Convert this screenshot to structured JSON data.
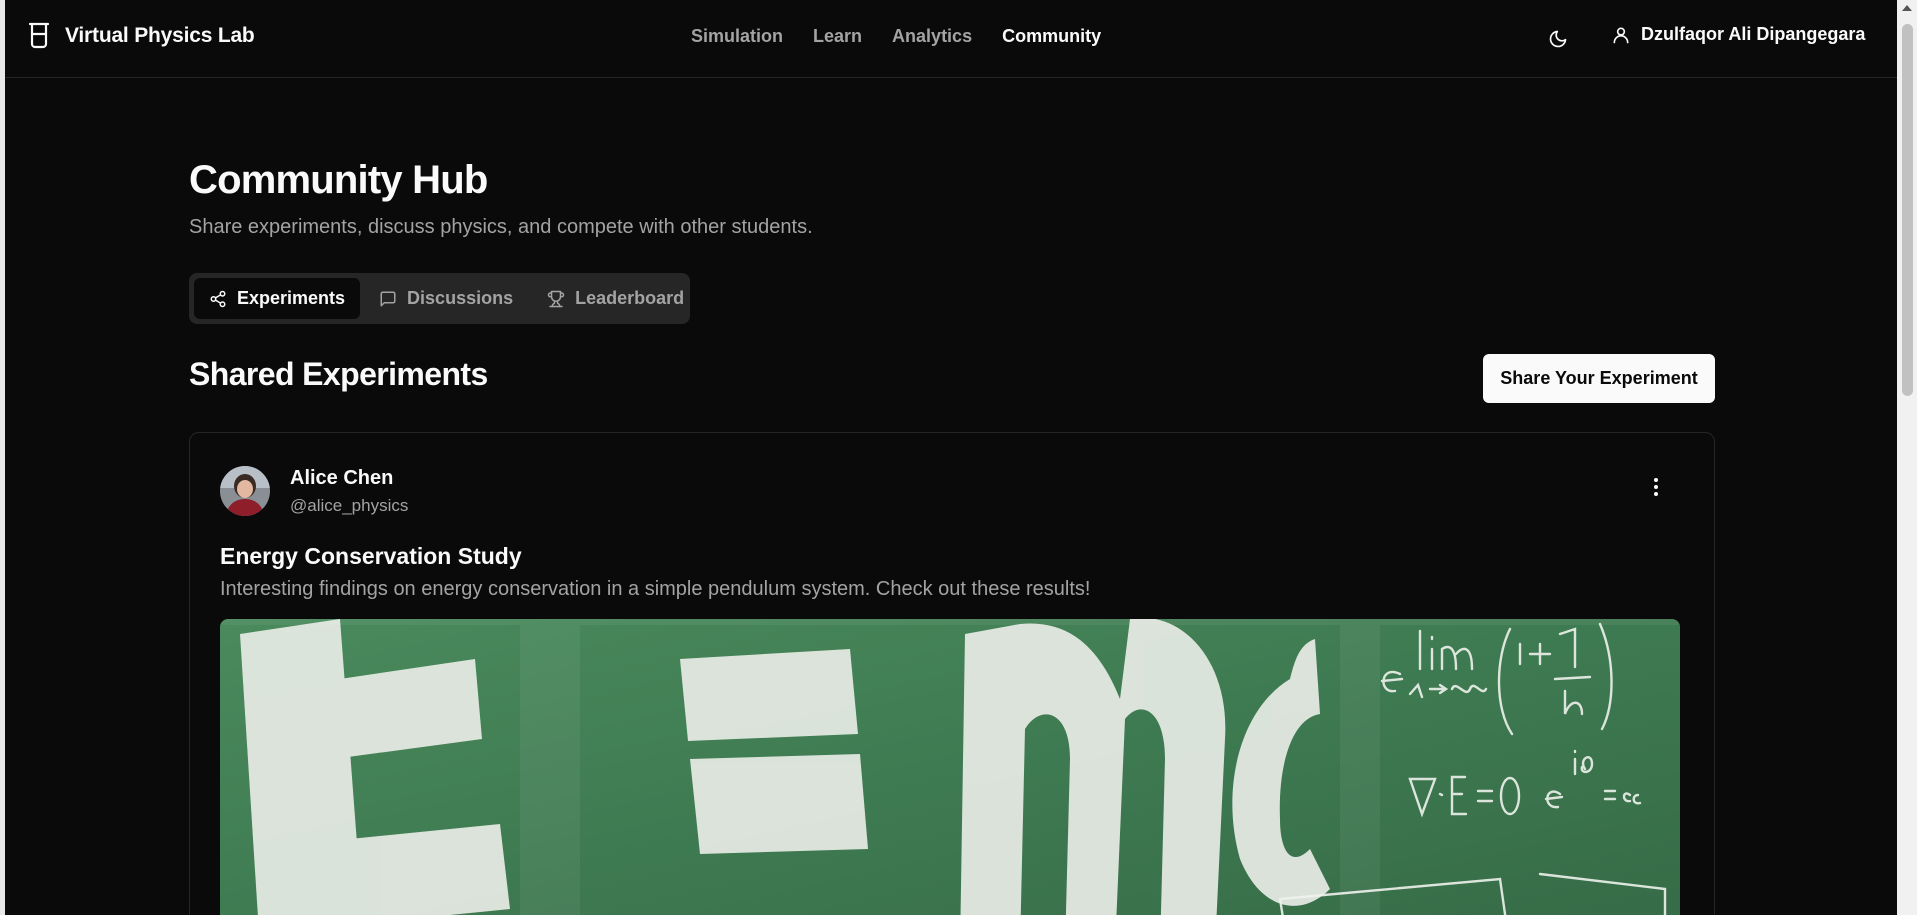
{
  "header": {
    "brand": "Virtual Physics Lab",
    "nav": [
      {
        "label": "Simulation",
        "active": false
      },
      {
        "label": "Learn",
        "active": false
      },
      {
        "label": "Analytics",
        "active": false
      },
      {
        "label": "Community",
        "active": true
      }
    ],
    "theme_icon": "moon-icon",
    "user_icon": "user-icon",
    "user_name": "Dzulfaqor Ali Dipangegara"
  },
  "page": {
    "title": "Community Hub",
    "subtitle": "Share experiments, discuss physics, and compete with other students."
  },
  "tabs": [
    {
      "label": "Experiments",
      "icon": "share-icon",
      "active": true
    },
    {
      "label": "Discussions",
      "icon": "message-square-icon",
      "active": false
    },
    {
      "label": "Leaderboard",
      "icon": "trophy-icon",
      "active": false
    }
  ],
  "section": {
    "title": "Shared Experiments",
    "share_button": "Share Your Experiment"
  },
  "posts": [
    {
      "author_name": "Alice Chen",
      "author_handle": "@alice_physics",
      "title": "Energy Conservation Study",
      "description": "Interesting findings on energy conservation in a simple pendulum system. Check out these results!"
    }
  ],
  "colors": {
    "background": "#0a0a0a",
    "foreground": "#fafafa",
    "muted": "#a3a3a3",
    "border": "#262626",
    "chalkboard": "#3f7a52"
  }
}
